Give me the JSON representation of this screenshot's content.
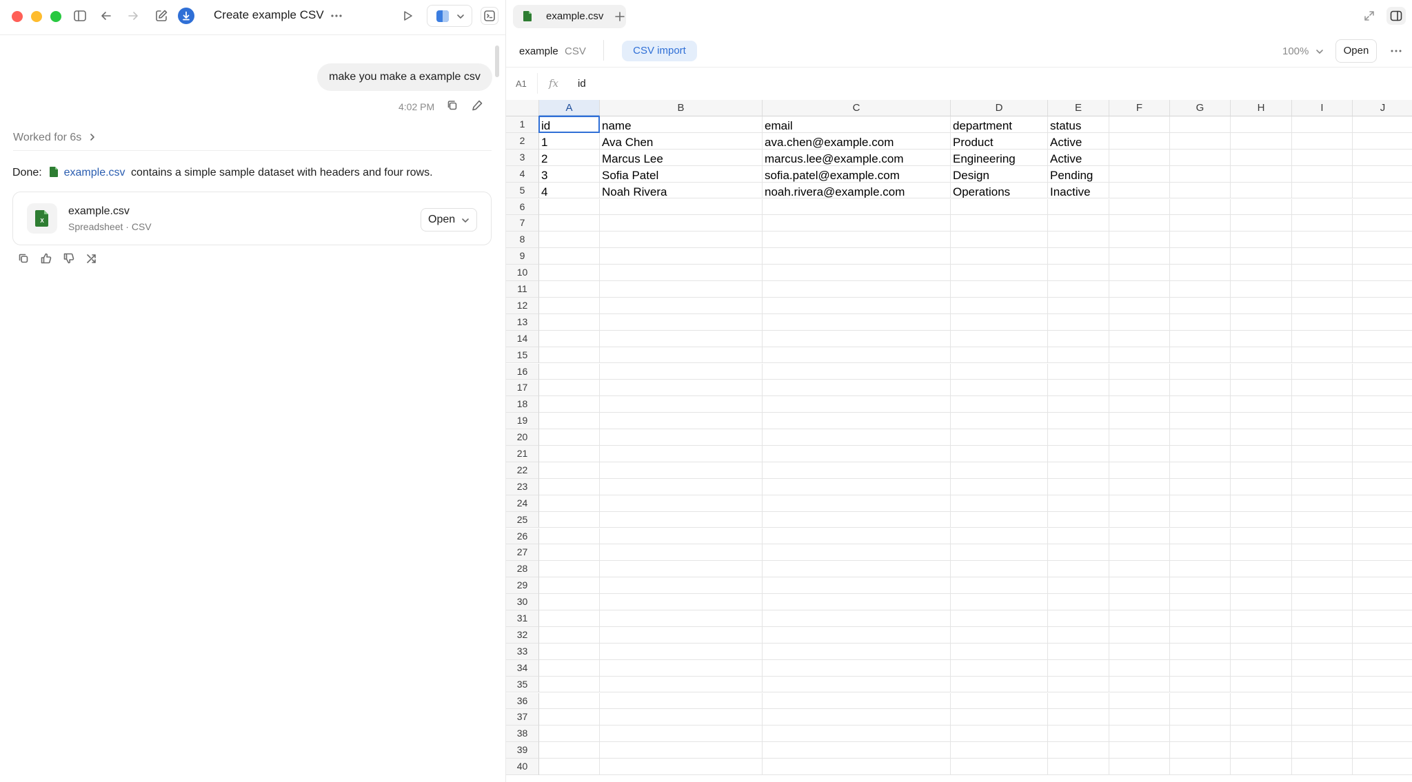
{
  "window": {
    "title": "Create example CSV",
    "colors": {
      "close": "#ff5f57",
      "minimize": "#febc2e",
      "maximize": "#28c840",
      "accent": "#2f6fd6"
    }
  },
  "chat": {
    "user_message": "make you make a example csv",
    "message_time": "4:02 PM",
    "worked_label": "Worked for 6s",
    "done_prefix": "Done:",
    "done_link": "example.csv",
    "done_suffix": "contains a simple sample dataset with headers and four rows.",
    "file_card": {
      "name": "example.csv",
      "subtitle": "Spreadsheet · CSV",
      "open_label": "Open"
    }
  },
  "viewer": {
    "tab_label": "example.csv",
    "doc_name": "example",
    "doc_type": "CSV",
    "import_label": "CSV import",
    "zoom": "100%",
    "open_label": "Open",
    "cell_ref": "A1",
    "fx_label": "fx",
    "formula_value": "id"
  },
  "sheet": {
    "columns": [
      "A",
      "B",
      "C",
      "D",
      "E",
      "F",
      "G",
      "H",
      "I",
      "J"
    ],
    "selected_column": "A",
    "selected_cell": "A1",
    "row_count": 40,
    "rows": [
      [
        "id",
        "name",
        "email",
        "department",
        "status"
      ],
      [
        "1",
        "Ava Chen",
        "ava.chen@example.com",
        "Product",
        "Active"
      ],
      [
        "2",
        "Marcus Lee",
        "marcus.lee@example.com",
        "Engineering",
        "Active"
      ],
      [
        "3",
        "Sofia Patel",
        "sofia.patel@example.com",
        "Design",
        "Pending"
      ],
      [
        "4",
        "Noah Rivera",
        "noah.rivera@example.com",
        "Operations",
        "Inactive"
      ]
    ]
  }
}
